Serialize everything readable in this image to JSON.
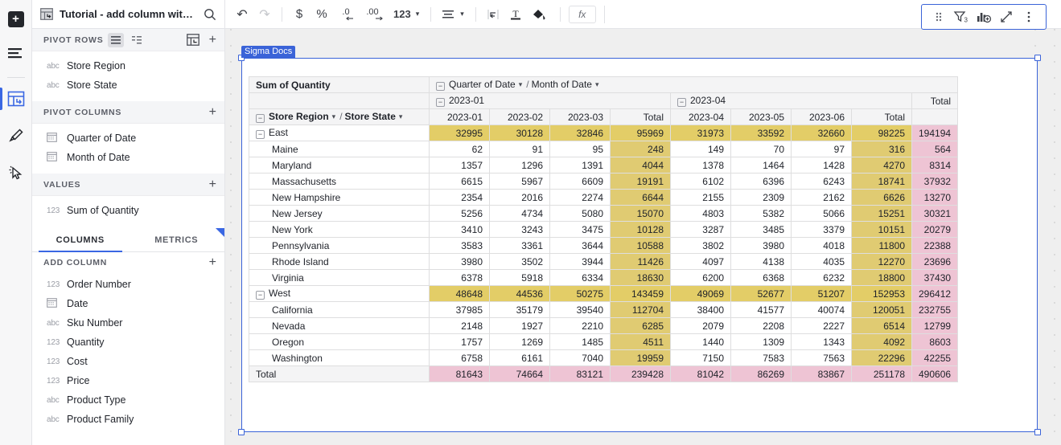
{
  "rail": {
    "items": [
      {
        "name": "add-button",
        "icon": "plus-icon",
        "label": "+"
      },
      {
        "name": "list-button",
        "icon": "list-lines-icon",
        "label": ""
      },
      {
        "name": "pivot-table-button",
        "icon": "pivot-table-icon",
        "label": ""
      },
      {
        "name": "paintbrush-button",
        "icon": "paintbrush-icon",
        "label": ""
      },
      {
        "name": "cursor-select-button",
        "icon": "cursor-click-icon",
        "label": ""
      }
    ]
  },
  "panel": {
    "title": "Tutorial - add column with...",
    "search_icon": "search-icon",
    "doc_icon": "pivot-doc-icon",
    "sections": [
      {
        "id": "pivot-rows",
        "label": "PIVOT ROWS",
        "fields": [
          {
            "type": "abc",
            "label": "Store Region"
          },
          {
            "type": "abc",
            "label": "Store State"
          }
        ]
      },
      {
        "id": "pivot-columns",
        "label": "PIVOT COLUMNS",
        "fields": [
          {
            "type": "date",
            "label": "Quarter of Date"
          },
          {
            "type": "date",
            "label": "Month of Date"
          }
        ]
      },
      {
        "id": "values",
        "label": "VALUES",
        "fields": [
          {
            "type": "123",
            "label": "Sum of Quantity"
          }
        ]
      }
    ],
    "tabs": [
      {
        "label": "COLUMNS",
        "active": true
      },
      {
        "label": "METRICS",
        "active": false
      }
    ],
    "add_column_label": "ADD COLUMN",
    "columns": [
      {
        "type": "123",
        "label": "Order Number"
      },
      {
        "type": "date",
        "label": "Date"
      },
      {
        "type": "abc",
        "label": "Sku Number"
      },
      {
        "type": "123",
        "label": "Quantity"
      },
      {
        "type": "123",
        "label": "Cost"
      },
      {
        "type": "123",
        "label": "Price"
      },
      {
        "type": "abc",
        "label": "Product Type"
      },
      {
        "type": "abc",
        "label": "Product Family"
      }
    ]
  },
  "toolbar": {
    "buttons": [
      {
        "name": "undo-icon",
        "glyph": "↶"
      },
      {
        "name": "redo-icon",
        "glyph": "↷"
      },
      {
        "name": "currency-icon",
        "glyph": "$"
      },
      {
        "name": "percent-icon",
        "glyph": "%"
      },
      {
        "name": "decrease-decimal-icon",
        "glyph": ".0"
      },
      {
        "name": "increase-decimal-icon",
        "glyph": ".00"
      },
      {
        "name": "number-format-icon",
        "glyph": "123"
      },
      {
        "name": "align-icon",
        "glyph": "☰"
      },
      {
        "name": "wrap-text-icon",
        "glyph": "↵"
      },
      {
        "name": "text-color-icon",
        "glyph": "T"
      },
      {
        "name": "fill-color-icon",
        "glyph": "◢"
      },
      {
        "name": "formula-icon",
        "glyph": "fx"
      }
    ]
  },
  "element": {
    "tag_label": "Sigma Docs",
    "toolbar": [
      {
        "name": "drag-handle-icon"
      },
      {
        "name": "filter-icon",
        "badge": "3"
      },
      {
        "name": "add-chart-icon"
      },
      {
        "name": "expand-icon"
      },
      {
        "name": "more-options-icon"
      }
    ]
  },
  "chart_data": {
    "type": "table",
    "title": "Sum of Quantity",
    "row_header": {
      "level1": "Store Region",
      "level2": "Store State"
    },
    "column_header": {
      "level1": "Quarter of Date",
      "level2": "Month of Date"
    },
    "quarter_groups": [
      {
        "label": "2023-01",
        "months": [
          "2023-01",
          "2023-02",
          "2023-03"
        ],
        "total_label": "Total"
      },
      {
        "label": "2023-04",
        "months": [
          "2023-04",
          "2023-05",
          "2023-06"
        ],
        "total_label": "Total"
      }
    ],
    "grand_total_label": "Total",
    "columns": [
      "2023-01",
      "2023-02",
      "2023-03",
      "Total",
      "2023-04",
      "2023-05",
      "2023-06",
      "Total",
      "Total"
    ],
    "rows": [
      {
        "label": "East",
        "level": "group",
        "values": [
          32995,
          30128,
          32846,
          95969,
          31973,
          33592,
          32660,
          98225,
          194194
        ]
      },
      {
        "label": "Maine",
        "level": "state",
        "values": [
          62,
          91,
          95,
          248,
          149,
          70,
          97,
          316,
          564
        ]
      },
      {
        "label": "Maryland",
        "level": "state",
        "values": [
          1357,
          1296,
          1391,
          4044,
          1378,
          1464,
          1428,
          4270,
          8314
        ]
      },
      {
        "label": "Massachusetts",
        "level": "state",
        "values": [
          6615,
          5967,
          6609,
          19191,
          6102,
          6396,
          6243,
          18741,
          37932
        ]
      },
      {
        "label": "New Hampshire",
        "level": "state",
        "values": [
          2354,
          2016,
          2274,
          6644,
          2155,
          2309,
          2162,
          6626,
          13270
        ]
      },
      {
        "label": "New Jersey",
        "level": "state",
        "values": [
          5256,
          4734,
          5080,
          15070,
          4803,
          5382,
          5066,
          15251,
          30321
        ]
      },
      {
        "label": "New York",
        "level": "state",
        "values": [
          3410,
          3243,
          3475,
          10128,
          3287,
          3485,
          3379,
          10151,
          20279
        ]
      },
      {
        "label": "Pennsylvania",
        "level": "state",
        "values": [
          3583,
          3361,
          3644,
          10588,
          3802,
          3980,
          4018,
          11800,
          22388
        ]
      },
      {
        "label": "Rhode Island",
        "level": "state",
        "values": [
          3980,
          3502,
          3944,
          11426,
          4097,
          4138,
          4035,
          12270,
          23696
        ]
      },
      {
        "label": "Virginia",
        "level": "state",
        "values": [
          6378,
          5918,
          6334,
          18630,
          6200,
          6368,
          6232,
          18800,
          37430
        ]
      },
      {
        "label": "West",
        "level": "group",
        "values": [
          48648,
          44536,
          50275,
          143459,
          49069,
          52677,
          51207,
          152953,
          296412
        ]
      },
      {
        "label": "California",
        "level": "state",
        "values": [
          37985,
          35179,
          39540,
          112704,
          38400,
          41577,
          40074,
          120051,
          232755
        ]
      },
      {
        "label": "Nevada",
        "level": "state",
        "values": [
          2148,
          1927,
          2210,
          6285,
          2079,
          2208,
          2227,
          6514,
          12799
        ]
      },
      {
        "label": "Oregon",
        "level": "state",
        "values": [
          1757,
          1269,
          1485,
          4511,
          1440,
          1309,
          1343,
          4092,
          8603
        ]
      },
      {
        "label": "Washington",
        "level": "state",
        "values": [
          6758,
          6161,
          7040,
          19959,
          7150,
          7583,
          7563,
          22296,
          42255
        ]
      },
      {
        "label": "Total",
        "level": "grand",
        "values": [
          81643,
          74664,
          83121,
          239428,
          81042,
          86269,
          83867,
          251178,
          490606
        ]
      }
    ],
    "colors": {
      "group_highlight": "#e3cd67",
      "subtotal_highlight": "#e0cb72",
      "grand_total": "#eec4d4",
      "header_bg": "#f4f4f5",
      "accent": "#3a63d8"
    }
  }
}
